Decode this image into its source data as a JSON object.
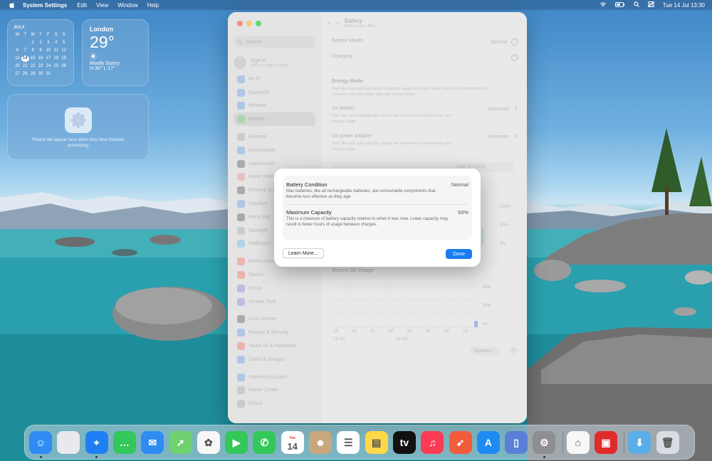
{
  "menubar": {
    "app_name": "System Settings",
    "menus": [
      "Edit",
      "View",
      "Window",
      "Help"
    ],
    "clock": "Tue 14 Jul  13:30"
  },
  "widgets": {
    "calendar": {
      "month": "JULY",
      "weekdays": [
        "M",
        "T",
        "W",
        "T",
        "F",
        "S",
        "S"
      ],
      "days": [
        "",
        "",
        "1",
        "2",
        "3",
        "4",
        "5",
        "6",
        "7",
        "8",
        "9",
        "10",
        "11",
        "12",
        "13",
        "14",
        "15",
        "16",
        "17",
        "18",
        "19",
        "20",
        "21",
        "22",
        "23",
        "24",
        "25",
        "26",
        "27",
        "28",
        "29",
        "30",
        "31",
        "",
        ""
      ],
      "today": "14"
    },
    "weather": {
      "city": "London",
      "temp": "29°",
      "condition": "Mostly Sunny",
      "high_low": "H:30° L:17°"
    },
    "photos": {
      "message": "Photos will appear here when they have finished processing"
    }
  },
  "settings": {
    "search_placeholder": "Search",
    "sign_in": {
      "title": "Sign in",
      "subtitle": "with your Apple account"
    },
    "sidebar_items": [
      {
        "label": "Wi-Fi",
        "color": "#2f7cf6"
      },
      {
        "label": "Bluetooth",
        "color": "#2f7cf6"
      },
      {
        "label": "Network",
        "color": "#2f7cf6"
      },
      {
        "label": "Battery",
        "color": "#34c759",
        "active": true
      },
      {
        "label": "General",
        "color": "#8e8e93"
      },
      {
        "label": "Accessibility",
        "color": "#2f7cf6"
      },
      {
        "label": "Appearance",
        "color": "#1d1d1f"
      },
      {
        "label": "Apple Intelligence",
        "color": "#ff6b6b"
      },
      {
        "label": "Desktop & Dock",
        "color": "#1d1d1f"
      },
      {
        "label": "Displays",
        "color": "#2f7cf6"
      },
      {
        "label": "Menu Bar",
        "color": "#1d1d1f"
      },
      {
        "label": "Spotlight",
        "color": "#8e8e93"
      },
      {
        "label": "Wallpaper",
        "color": "#35aaf2"
      },
      {
        "label": "Notifications",
        "color": "#ff3b30"
      },
      {
        "label": "Sound",
        "color": "#ff3b30"
      },
      {
        "label": "Focus",
        "color": "#5e5ce6"
      },
      {
        "label": "Screen Time",
        "color": "#5e5ce6"
      },
      {
        "label": "Lock Screen",
        "color": "#1d1d1f"
      },
      {
        "label": "Privacy & Security",
        "color": "#2f7cf6"
      },
      {
        "label": "Touch ID & Password",
        "color": "#ff3b30"
      },
      {
        "label": "Users & Groups",
        "color": "#2f7cf6"
      },
      {
        "label": "Internet Accounts",
        "color": "#2f7cf6"
      },
      {
        "label": "Game Center",
        "color": "#8e8e93"
      },
      {
        "label": "iCloud",
        "color": "#8e8e93"
      }
    ],
    "title": "Battery",
    "subtitle": "Battery Level: 46%",
    "battery_health_label": "Battery Health",
    "battery_health_value": "Normal",
    "charging_label": "Charging",
    "energy_mode_title": "Energy Mode",
    "energy_mode_desc": "Your Mac can optimise either its battery usage with Low Power Mode or its performance in resource-intensive tasks with High Power Mode.",
    "on_battery_label": "On battery",
    "on_battery_value": "Automatic",
    "on_battery_desc": "Your Mac will automatically choose the best level of performance and energy usage.",
    "on_adapter_label": "On power adapter",
    "on_adapter_value": "Automatic",
    "on_adapter_desc": "Your Mac will automatically choose the best level of performance and energy usage.",
    "segment_right": "Last 10 Days",
    "level_ticks": [
      "100%",
      "50%",
      "0%"
    ],
    "usage_title": "Screen On Usage",
    "usage_ticks": [
      "60m",
      "30m",
      "0m"
    ],
    "usage_x_ticks": [
      "15",
      "18",
      "21",
      "00",
      "03",
      "06",
      "09",
      "12"
    ],
    "usage_dates": [
      "13 Jul",
      "14 Jul"
    ],
    "options_label": "Options...",
    "help_label": "?"
  },
  "modal": {
    "condition_label": "Battery Condition",
    "condition_value": "Normal",
    "condition_desc": "Mac batteries, like all rechargeable batteries, are consumable components that become less effective as they age.",
    "capacity_label": "Maximum Capacity",
    "capacity_value": "93%",
    "capacity_desc": "This is a measure of battery capacity relative to when it was new. Lower capacity may result in fewer hours of usage between charges.",
    "learn_more": "Learn More...",
    "done": "Done"
  },
  "dock": {
    "apps": [
      {
        "name": "Finder",
        "color": "#2f8cf2",
        "glyph": "☺",
        "running": true
      },
      {
        "name": "Launchpad",
        "color": "#e8e8ee",
        "glyph": ""
      },
      {
        "name": "Safari",
        "color": "#1f7ff2",
        "glyph": "⌖",
        "running": true
      },
      {
        "name": "Messages",
        "color": "#34c759",
        "glyph": "…"
      },
      {
        "name": "Mail",
        "color": "#2f8cf2",
        "glyph": "✉"
      },
      {
        "name": "Maps",
        "color": "#6fd26f",
        "glyph": "➚"
      },
      {
        "name": "Photos",
        "color": "#f7f7f7",
        "glyph": "✿"
      },
      {
        "name": "FaceTime",
        "color": "#34c759",
        "glyph": "▶"
      },
      {
        "name": "Phone",
        "color": "#34c759",
        "glyph": "✆"
      },
      {
        "name": "Calendar",
        "color": "#ffffff",
        "glyph": "14",
        "sub": "Tue"
      },
      {
        "name": "Contacts",
        "color": "#c9a77e",
        "glyph": "☻"
      },
      {
        "name": "Reminders",
        "color": "#ffffff",
        "glyph": "☰"
      },
      {
        "name": "Notes",
        "color": "#ffd84a",
        "glyph": "▤"
      },
      {
        "name": "TV",
        "color": "#111111",
        "glyph": "tv"
      },
      {
        "name": "Music",
        "color": "#fa3b53",
        "glyph": "♫"
      },
      {
        "name": "Rocket",
        "color": "#f25c3a",
        "glyph": "➶"
      },
      {
        "name": "App Store",
        "color": "#1d8bf2",
        "glyph": "A"
      },
      {
        "name": "iPhone Mirroring",
        "color": "#5a7fd6",
        "glyph": "▯"
      },
      {
        "name": "System Settings",
        "color": "#8e8e93",
        "glyph": "⚙",
        "running": true
      },
      {
        "name": "Home",
        "color": "#f7f7f7",
        "glyph": "⌂"
      },
      {
        "name": "Photo Booth",
        "color": "#e02b2b",
        "glyph": "▣"
      },
      {
        "name": "Downloads",
        "color": "#5aaee8",
        "glyph": "⬇"
      },
      {
        "name": "Trash",
        "color": "#d9dde2",
        "glyph": "🗑"
      }
    ]
  }
}
